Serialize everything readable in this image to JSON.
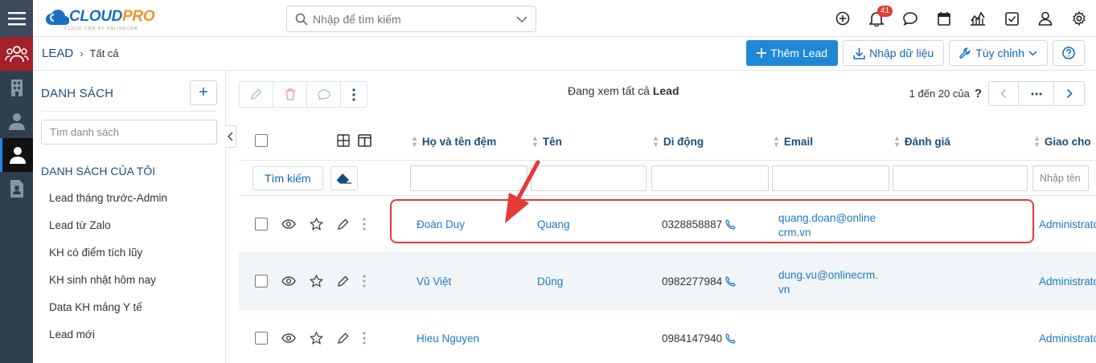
{
  "app": {
    "logo_main": "CLOUD",
    "logo_accent": "PRO",
    "logo_sub": "CLOUD CRM BY ONLINECRM"
  },
  "search": {
    "placeholder": "Nhập để tìm kiếm"
  },
  "notifications": {
    "count": "41"
  },
  "breadcrumb": {
    "module": "LEAD",
    "current": "Tất cả"
  },
  "toolbar": {
    "add_lead": "Thêm Lead",
    "import": "Nhập dữ liệu",
    "customize": "Tùy chỉnh"
  },
  "sidebar": {
    "title": "DANH SÁCH",
    "search_placeholder": "Tìm danh sách",
    "section": "DANH SÁCH CỦA TÔI",
    "items": [
      "Lead tháng trước-Admin",
      "Lead từ Zalo",
      "KH có điểm tích lũy",
      "KH sinh nhật hôm nay",
      "Data KH mảng Y tế",
      "Lead mới"
    ]
  },
  "list": {
    "viewing_prefix": "Đang xem tất cả",
    "viewing_module": "Lead",
    "range": "1 đến 20 của",
    "range_help": "?",
    "search_button": "Tìm kiếm",
    "filter_placeholder": "Nhập tên",
    "columns": [
      "Họ và tên đệm",
      "Tên",
      "Di động",
      "Email",
      "Đánh giá",
      "Giao cho"
    ],
    "rows": [
      {
        "last": "Đoàn Duy",
        "first": "Quang",
        "mobile": "0328858887",
        "email1": "quang.doan@online",
        "email2": "crm.vn",
        "assigned": "Administrator"
      },
      {
        "last": "Vũ Việt",
        "first": "Dũng",
        "mobile": "0982277984",
        "email1": "dung.vu@onlinecrm.",
        "email2": "vn",
        "assigned": "Administrator"
      },
      {
        "last": "Hieu Nguyen",
        "first": "",
        "mobile": "0984147940",
        "email1": "",
        "email2": "",
        "assigned": "Administrator"
      }
    ]
  },
  "colors": {
    "rail": "#2f3e4d",
    "rail_leads": "#a3212a",
    "primary": "#1e88d7",
    "link": "#1e78c8",
    "heading": "#1b4f7a",
    "highlight": "#e53935"
  }
}
